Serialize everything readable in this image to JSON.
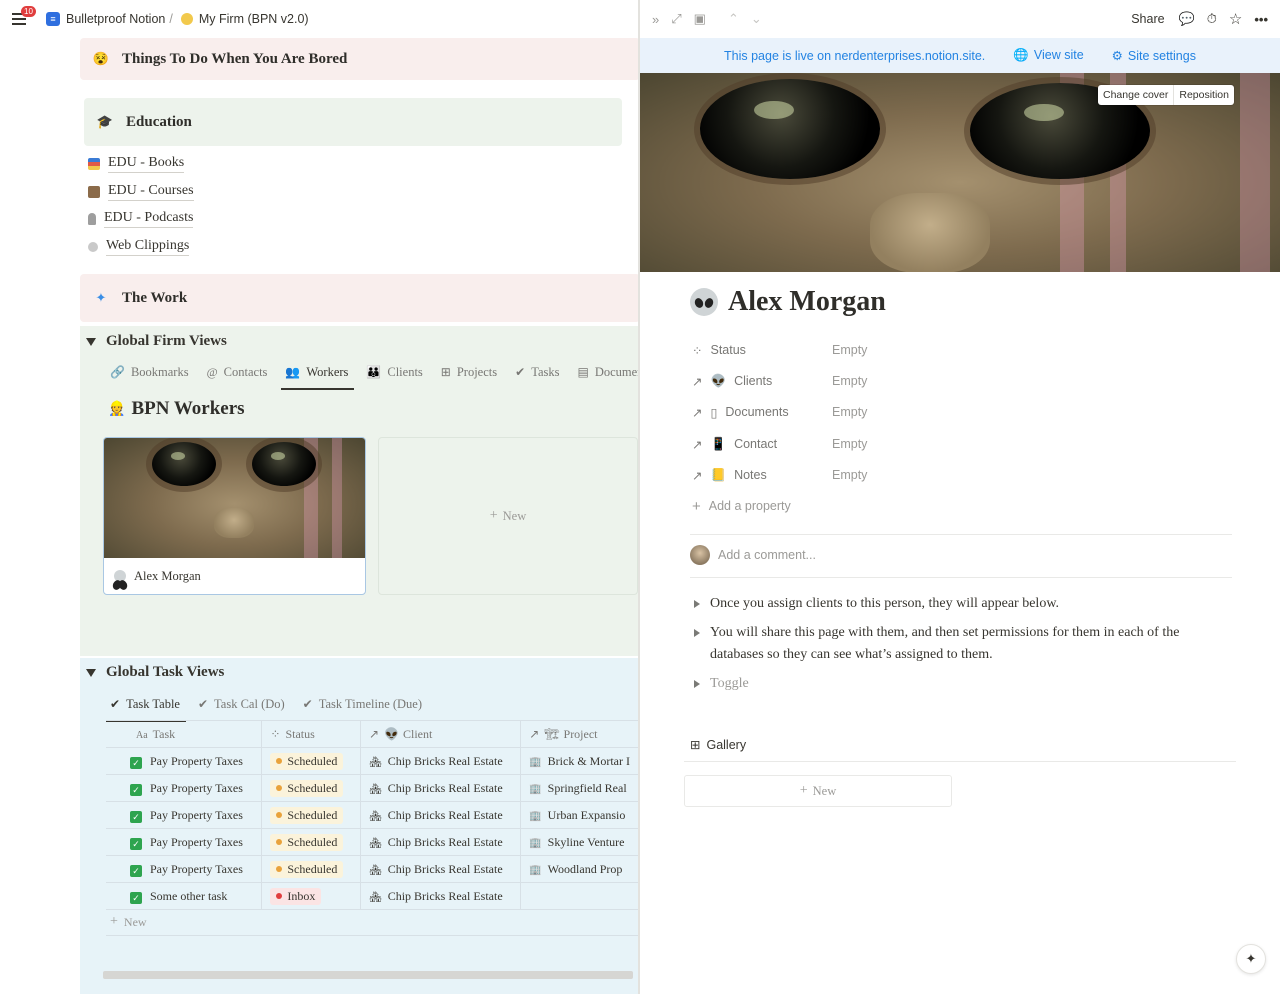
{
  "topbar": {
    "notification_count": "10",
    "workspace": "Bulletproof Notion",
    "separator": "/",
    "page": "My Firm (BPN v2.0)"
  },
  "callouts": {
    "bored": "Things To Do When You Are Bored",
    "education": "Education",
    "work": "The Work"
  },
  "education_links": [
    "EDU - Books",
    "EDU - Courses",
    "EDU - Podcasts",
    "Web Clippings"
  ],
  "firm_views": {
    "heading": "Global Firm Views",
    "tabs": [
      "Bookmarks",
      "Contacts",
      "Workers",
      "Clients",
      "Projects",
      "Tasks",
      "Documents"
    ],
    "active_tab": "Workers",
    "db_title": "BPN Workers",
    "card_name": "Alex Morgan",
    "new_label": "New"
  },
  "task_views": {
    "heading": "Global Task Views",
    "tabs": [
      "Task Table",
      "Task Cal (Do)",
      "Task Timeline (Due)"
    ],
    "active_tab": "Task Table",
    "columns": [
      "Task",
      "Status",
      "Client",
      "Project"
    ],
    "rows": [
      {
        "task": "Pay Property Taxes",
        "status": "Scheduled",
        "client": "Chip Bricks Real Estate",
        "project": "Brick & Mortar I"
      },
      {
        "task": "Pay Property Taxes",
        "status": "Scheduled",
        "client": "Chip Bricks Real Estate",
        "project": "Springfield Real"
      },
      {
        "task": "Pay Property Taxes",
        "status": "Scheduled",
        "client": "Chip Bricks Real Estate",
        "project": "Urban Expansio"
      },
      {
        "task": "Pay Property Taxes",
        "status": "Scheduled",
        "client": "Chip Bricks Real Estate",
        "project": "Skyline Venture"
      },
      {
        "task": "Pay Property Taxes",
        "status": "Scheduled",
        "client": "Chip Bricks Real Estate",
        "project": "Woodland Prop"
      },
      {
        "task": "Some other task",
        "status": "Inbox",
        "client": "Chip Bricks Real Estate",
        "project": ""
      }
    ],
    "new_label": "New"
  },
  "right_top": {
    "share": "Share"
  },
  "banner": {
    "live_text": "This page is live on nerdenterprises.notion.site.",
    "view_site": "View site",
    "site_settings": "Site settings"
  },
  "cover": {
    "change_cover": "Change cover",
    "reposition": "Reposition"
  },
  "page": {
    "title": "Alex Morgan",
    "properties": [
      {
        "name": "Status",
        "value": "Empty"
      },
      {
        "name": "Clients",
        "value": "Empty"
      },
      {
        "name": "Documents",
        "value": "Empty"
      },
      {
        "name": "Contact",
        "value": "Empty"
      },
      {
        "name": "Notes",
        "value": "Empty"
      }
    ],
    "add_property": "Add a property",
    "comment_placeholder": "Add a comment...",
    "toggles": [
      "Once you assign clients to this person, they will appear below.",
      "You will share this page with them, and then set permissions for them in each of the databases so they can see what’s assigned to them.",
      "Toggle"
    ],
    "gallery_label": "Gallery",
    "gallery_new": "New"
  },
  "colors": {
    "accent": "#2383e2",
    "scheduled_bg": "#fbf3db",
    "scheduled_dot": "#e9a23b",
    "inbox_bg": "#fbe4e4",
    "inbox_dot": "#e03e3e",
    "pink_callout": "#f9eeed",
    "green_callout": "#edf3ec",
    "blue_section": "#e7f3f8"
  }
}
